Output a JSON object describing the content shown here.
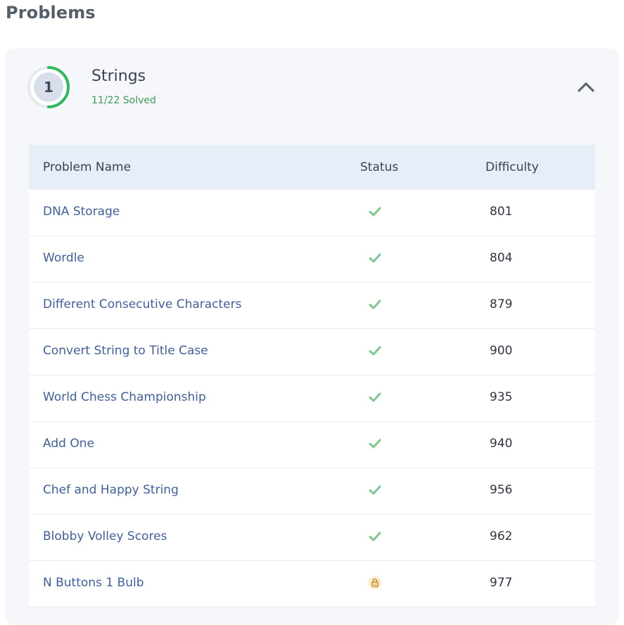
{
  "page": {
    "title": "Problems"
  },
  "topic": {
    "number": "1",
    "title": "Strings",
    "solved_text": "11/22 Solved",
    "progress_fraction": 0.5,
    "accent_color": "#2fb85c",
    "collapse_icon": "chevron-up-icon"
  },
  "table": {
    "headers": {
      "name": "Problem Name",
      "status": "Status",
      "difficulty": "Difficulty"
    },
    "rows": [
      {
        "name": "DNA Storage",
        "status": "solved",
        "status_icon": "check-icon",
        "difficulty": "801"
      },
      {
        "name": "Wordle",
        "status": "solved",
        "status_icon": "check-icon",
        "difficulty": "804"
      },
      {
        "name": "Different Consecutive Characters",
        "status": "solved",
        "status_icon": "check-icon",
        "difficulty": "879"
      },
      {
        "name": "Convert String to Title Case",
        "status": "solved",
        "status_icon": "check-icon",
        "difficulty": "900"
      },
      {
        "name": "World Chess Championship",
        "status": "solved",
        "status_icon": "check-icon",
        "difficulty": "935"
      },
      {
        "name": "Add One",
        "status": "solved",
        "status_icon": "check-icon",
        "difficulty": "940"
      },
      {
        "name": "Chef and Happy String",
        "status": "solved",
        "status_icon": "check-icon",
        "difficulty": "956"
      },
      {
        "name": "Blobby Volley Scores",
        "status": "solved",
        "status_icon": "check-icon",
        "difficulty": "962"
      },
      {
        "name": "N Buttons 1 Bulb",
        "status": "locked",
        "status_icon": "lock-icon",
        "difficulty": "977"
      }
    ]
  },
  "colors": {
    "check": "#7cc98f",
    "lock_bg": "#fbe9c6",
    "lock_fg": "#c08a2a",
    "link": "#3f5f9c"
  }
}
